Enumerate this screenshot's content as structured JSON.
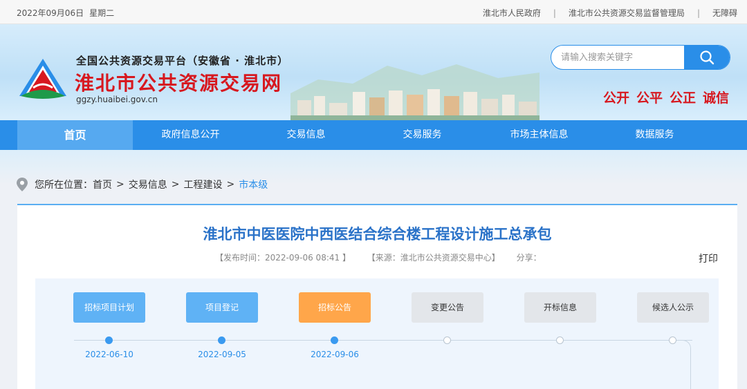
{
  "topbar": {
    "date": "2022年09月06日",
    "weekday": "星期二",
    "links": [
      "淮北市人民政府",
      "淮北市公共资源交易监督管理局",
      "无障碍"
    ]
  },
  "header": {
    "platform": "全国公共资源交易平台（安徽省 · 淮北市）",
    "site_title": "淮北市公共资源交易网",
    "url": "ggzy.huaibei.gov.cn",
    "search_placeholder": "请输入搜索关键字",
    "slogans": [
      "公开",
      "公平",
      "公正",
      "诚信"
    ]
  },
  "nav": {
    "items": [
      "首页",
      "政府信息公开",
      "交易信息",
      "交易服务",
      "市场主体信息",
      "数据服务"
    ],
    "active": "首页"
  },
  "breadcrumb": {
    "prefix": "您所在位置：",
    "items": [
      "首页",
      "交易信息",
      "工程建设",
      "市本级"
    ],
    "arrow": ">"
  },
  "article": {
    "title": "淮北市中医医院中西医结合综合楼工程设计施工总承包",
    "publish_time": "【发布时间：2022-09-06 08:41 】",
    "source": "【来源：淮北市公共资源交易中心】",
    "share": "分享：",
    "print": "打印"
  },
  "flow": {
    "steps": [
      {
        "label": "招标项目计划",
        "status": "done",
        "date": "2022-06-10"
      },
      {
        "label": "项目登记",
        "status": "done",
        "date": "2022-09-05"
      },
      {
        "label": "招标公告",
        "status": "current",
        "date": "2022-09-06"
      },
      {
        "label": "变更公告",
        "status": "todo",
        "date": ""
      },
      {
        "label": "开标信息",
        "status": "todo",
        "date": ""
      },
      {
        "label": "候选人公示",
        "status": "todo",
        "date": ""
      }
    ]
  },
  "colors": {
    "primary": "#2a8ee8",
    "brand_red": "#d7181f",
    "current_step": "#ffa64a",
    "done_step": "#5fb2f5"
  }
}
